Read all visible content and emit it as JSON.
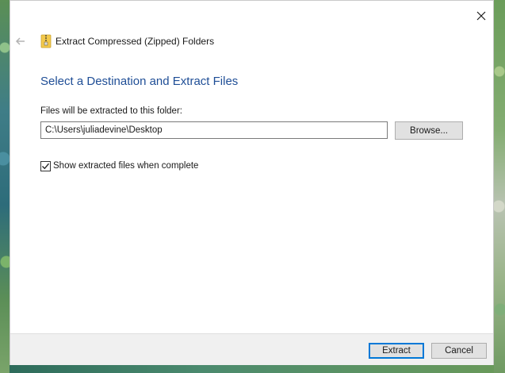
{
  "window": {
    "nav_title": "Extract Compressed (Zipped) Folders"
  },
  "main": {
    "heading": "Select a Destination and Extract Files",
    "folder_label": "Files will be extracted to this folder:",
    "path_value": "C:\\Users\\juliadevine\\Desktop",
    "browse_label": "Browse...",
    "show_files_label": "Show extracted files when complete",
    "show_files_checked": true
  },
  "footer": {
    "extract_label": "Extract",
    "cancel_label": "Cancel"
  },
  "icons": {
    "close": "close-icon",
    "back": "back-arrow-icon",
    "zip": "zip-folder-icon",
    "check": "checkmark-icon"
  },
  "colors": {
    "heading": "#1f4e96",
    "primary_border": "#0078d7"
  }
}
